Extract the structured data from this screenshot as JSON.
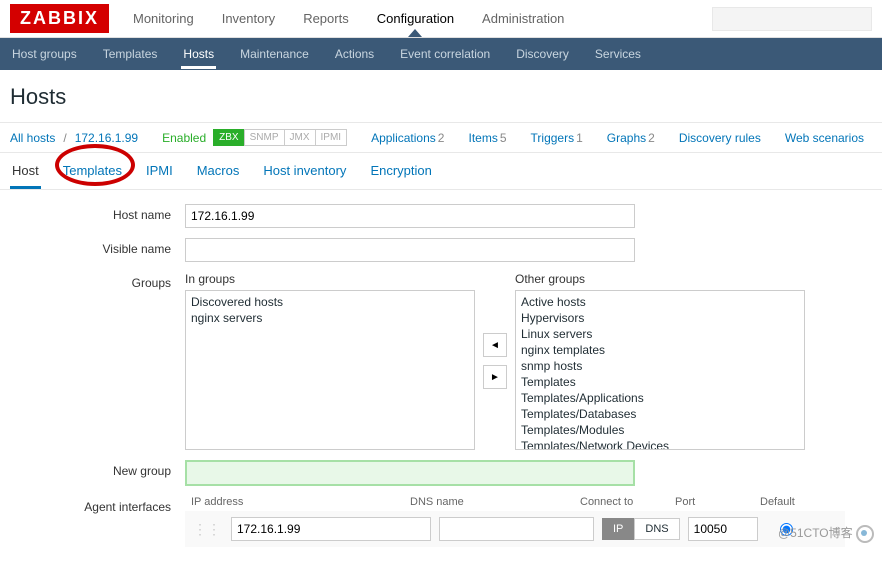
{
  "logo": "ZABBIX",
  "topnav": {
    "items": [
      "Monitoring",
      "Inventory",
      "Reports",
      "Configuration",
      "Administration"
    ],
    "active_index": 3
  },
  "subnav": {
    "items": [
      "Host groups",
      "Templates",
      "Hosts",
      "Maintenance",
      "Actions",
      "Event correlation",
      "Discovery",
      "Services"
    ],
    "active_index": 2
  },
  "page_title": "Hosts",
  "breadcrumb": {
    "all_hosts": "All hosts",
    "host_ip": "172.16.1.99",
    "status": "Enabled",
    "badges": {
      "zbx": "ZBX",
      "snmp": "SNMP",
      "jmx": "JMX",
      "ipmi": "IPMI"
    },
    "links": {
      "applications": {
        "label": "Applications",
        "count": "2"
      },
      "items": {
        "label": "Items",
        "count": "5"
      },
      "triggers": {
        "label": "Triggers",
        "count": "1"
      },
      "graphs": {
        "label": "Graphs",
        "count": "2"
      },
      "discovery": {
        "label": "Discovery rules"
      },
      "web": {
        "label": "Web scenarios"
      }
    }
  },
  "tabs": [
    "Host",
    "Templates",
    "IPMI",
    "Macros",
    "Host inventory",
    "Encryption"
  ],
  "form": {
    "host_name_label": "Host name",
    "host_name_value": "172.16.1.99",
    "visible_name_label": "Visible name",
    "visible_name_value": "",
    "groups_label": "Groups",
    "in_groups_label": "In groups",
    "other_groups_label": "Other groups",
    "in_groups": [
      "Discovered hosts",
      "nginx servers"
    ],
    "other_groups": [
      "Active hosts",
      "Hypervisors",
      "Linux servers",
      "nginx templates",
      "snmp hosts",
      "Templates",
      "Templates/Applications",
      "Templates/Databases",
      "Templates/Modules",
      "Templates/Network Devices"
    ],
    "new_group_label": "New group",
    "new_group_value": "",
    "agent_interfaces_label": "Agent interfaces",
    "iface_headers": {
      "ip": "IP address",
      "dns": "DNS name",
      "connect": "Connect to",
      "port": "Port",
      "default": "Default"
    },
    "iface": {
      "ip": "172.16.1.99",
      "dns": "",
      "connect_ip": "IP",
      "connect_dns": "DNS",
      "port": "10050"
    }
  },
  "move_btn_left": "◄",
  "move_btn_right": "►",
  "watermark": "@51CTO博客"
}
